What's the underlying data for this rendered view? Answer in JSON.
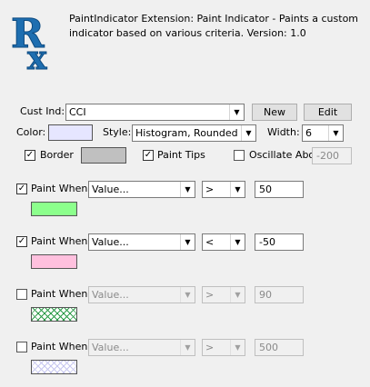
{
  "header": {
    "description": "PaintIndicator Extension: Paint Indicator - Paints a custom indicator based on various criteria. Version: 1.0",
    "logo_text": "Rx"
  },
  "indicator": {
    "label": "Cust Ind:",
    "value": "CCI",
    "new_label": "New",
    "edit_label": "Edit"
  },
  "style_row": {
    "color_label": "Color:",
    "color": "#e6e6ff",
    "style_label": "Style:",
    "style_value": "Histogram, Rounded",
    "width_label": "Width:",
    "width_value": "6"
  },
  "options_row": {
    "border_label": "Border",
    "border_checked": true,
    "border_color": "#c0c0c0",
    "paint_tips_label": "Paint Tips",
    "paint_tips_checked": true,
    "oscillate_label": "Oscillate About",
    "oscillate_checked": false,
    "oscillate_value": "-200"
  },
  "rules": [
    {
      "label": "Paint When",
      "checked": true,
      "field": "Value...",
      "op": ">",
      "value": "50",
      "color": "#8cff8c",
      "pattern": "solid"
    },
    {
      "label": "Paint When",
      "checked": true,
      "field": "Value...",
      "op": "<",
      "value": "-50",
      "color": "#ffc0de",
      "pattern": "solid"
    },
    {
      "label": "Paint When",
      "checked": false,
      "field": "Value...",
      "op": ">",
      "value": "90",
      "color": "#2e9c4a",
      "pattern": "crosshatch"
    },
    {
      "label": "Paint When",
      "checked": false,
      "field": "Value...",
      "op": ">",
      "value": "500",
      "color": "#c8c8f0",
      "pattern": "crosshatch-light"
    }
  ],
  "icons": {
    "dropdown": "chevron-down-icon",
    "check": "check-icon"
  }
}
